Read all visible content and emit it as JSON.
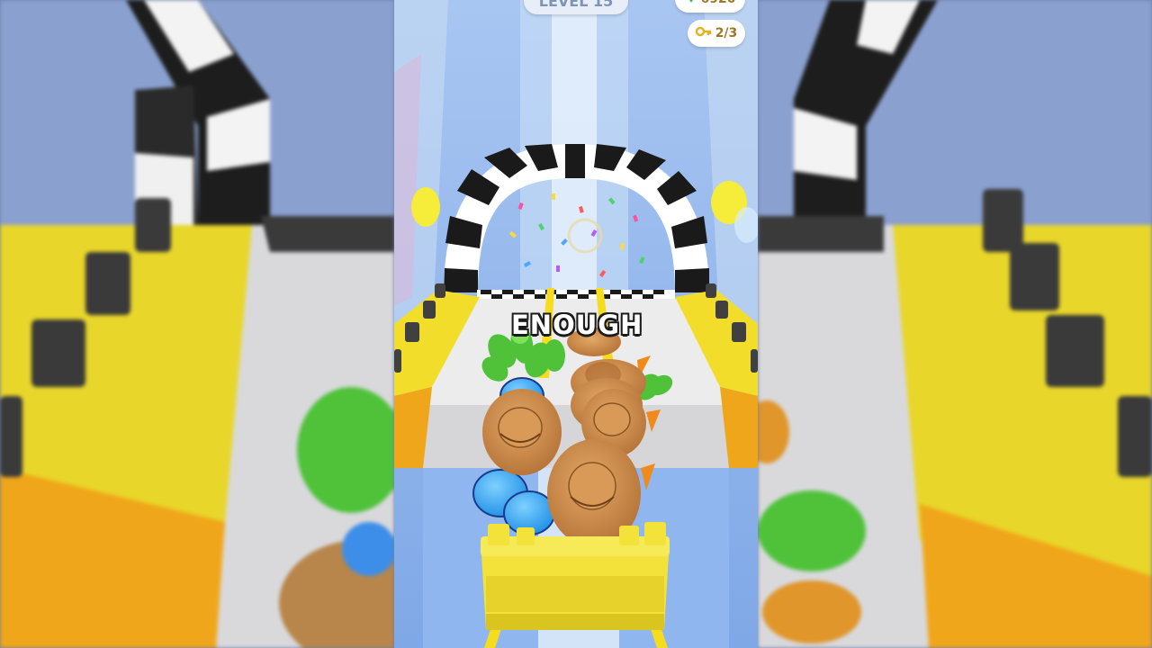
{
  "hud": {
    "level_label": "LEVEL 15",
    "gems_label": "6920",
    "keys_label": "2/3"
  },
  "feedback": {
    "word": "ENOUGH"
  },
  "icons": {
    "gem": "gem-icon",
    "key": "key-icon"
  },
  "colors": {
    "sky": "#8fb4ea",
    "track_yellow": "#f5dc1e",
    "arch_black": "#1a1a1a",
    "hat_brown": "#c98a4a",
    "cart_yellow": "#f2e23a"
  }
}
